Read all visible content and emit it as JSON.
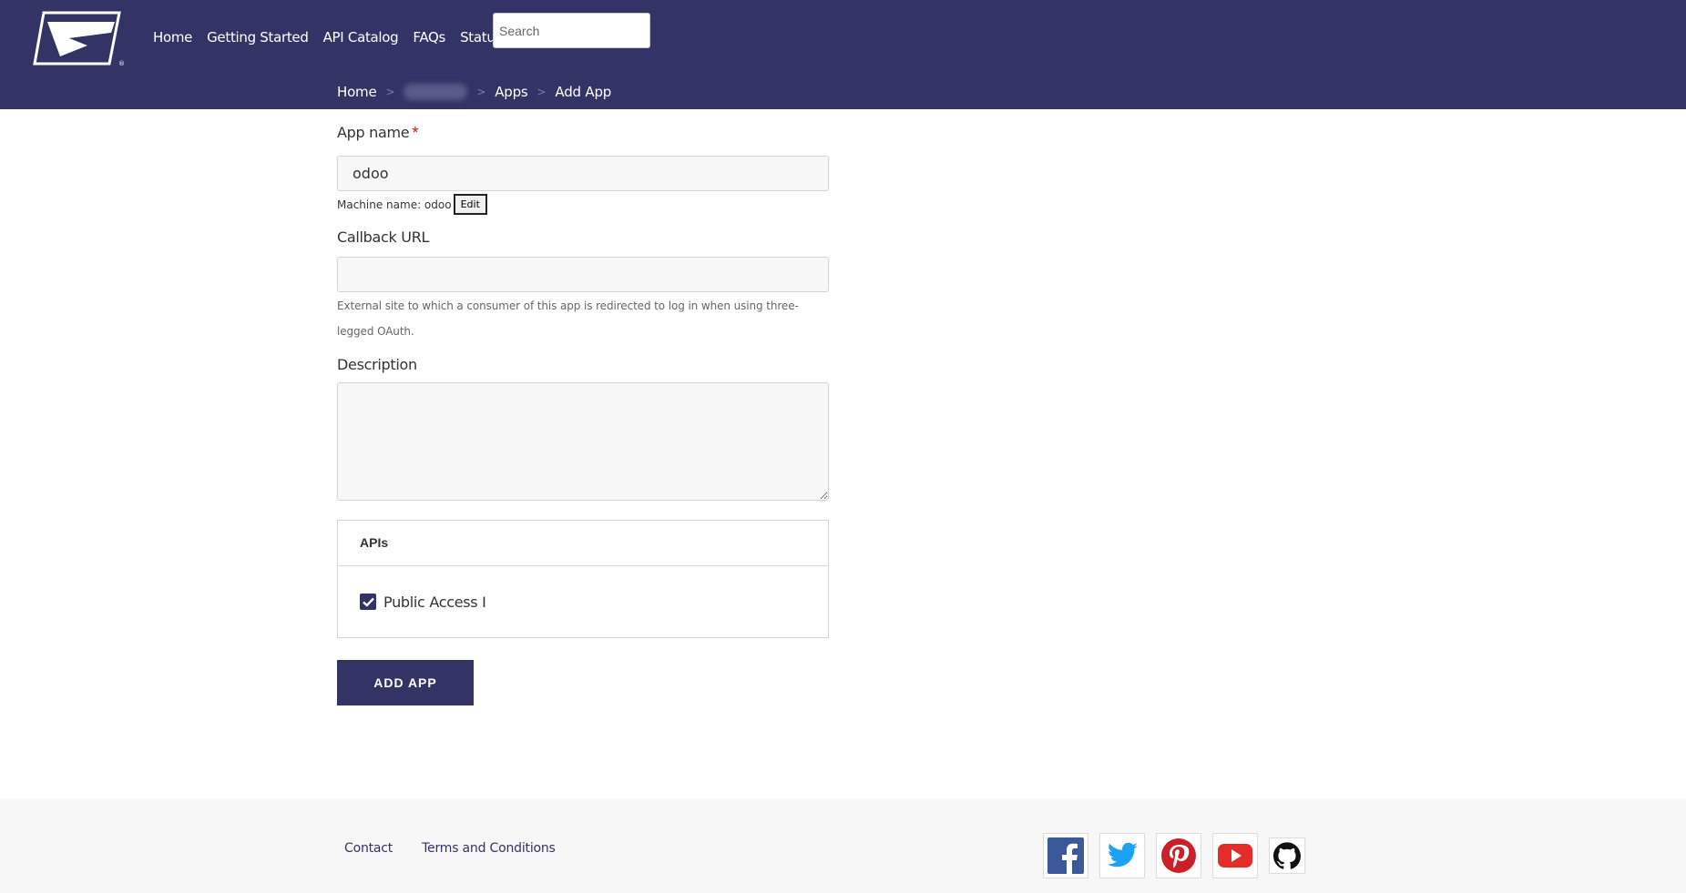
{
  "header": {
    "nav": [
      "Home",
      "Getting Started",
      "API Catalog",
      "FAQs",
      "Status"
    ],
    "search_placeholder": "Search"
  },
  "breadcrumb": {
    "items": [
      "Home",
      "Apps",
      "Add App"
    ],
    "separator": ">"
  },
  "form": {
    "app_name_label": "App name",
    "required_marker": "*",
    "app_name_value": "odoo",
    "machine_name_label": "Machine name: odoo",
    "edit_label": "Edit",
    "callback_label": "Callback URL",
    "callback_value": "",
    "callback_help": "External site to which a consumer of this app is redirected to log in when using three-legged OAuth.",
    "description_label": "Description",
    "description_value": "",
    "apis_title": "APIs",
    "api_item_label": "Public Access I",
    "api_item_checked": true,
    "submit_label": "ADD APP"
  },
  "footer": {
    "links": [
      "Contact",
      "Terms and Conditions"
    ],
    "social_icons": [
      "facebook-icon",
      "twitter-icon",
      "pinterest-icon",
      "youtube-icon",
      "github-icon"
    ]
  },
  "colors": {
    "brand": "#333366",
    "required": "#dd1111",
    "footer_bg": "#f7f7f7"
  }
}
